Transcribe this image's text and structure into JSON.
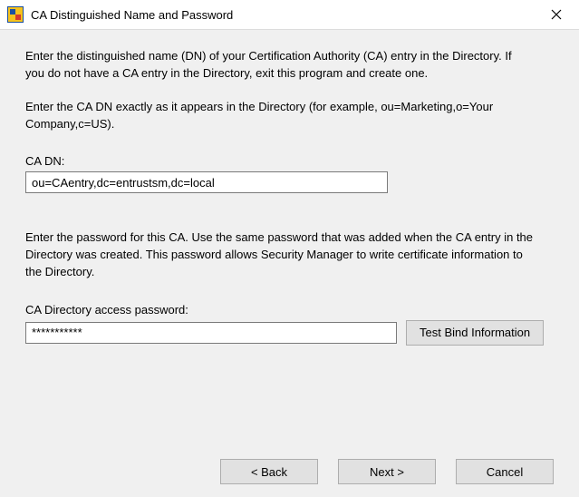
{
  "window": {
    "title": "CA Distinguished Name and Password"
  },
  "intro": {
    "para1": "Enter the distinguished name (DN) of your Certification Authority (CA) entry in the Directory.  If you do not have a CA entry in the Directory, exit this program and create one.",
    "para2": "Enter the CA DN exactly as it appears in the Directory (for example, ou=Marketing,o=Your Company,c=US)."
  },
  "dn": {
    "label": "CA DN:",
    "value": "ou=CAentry,dc=entrustsm,dc=local"
  },
  "password_section": {
    "para": "Enter the password for this CA.  Use the same password that was added when the CA entry in the Directory was created.   This password allows Security Manager to write certificate information to the Directory.",
    "label": "CA Directory access password:",
    "value": "***********",
    "test_button": "Test Bind Information"
  },
  "buttons": {
    "back": "< Back",
    "next": "Next >",
    "cancel": "Cancel"
  }
}
